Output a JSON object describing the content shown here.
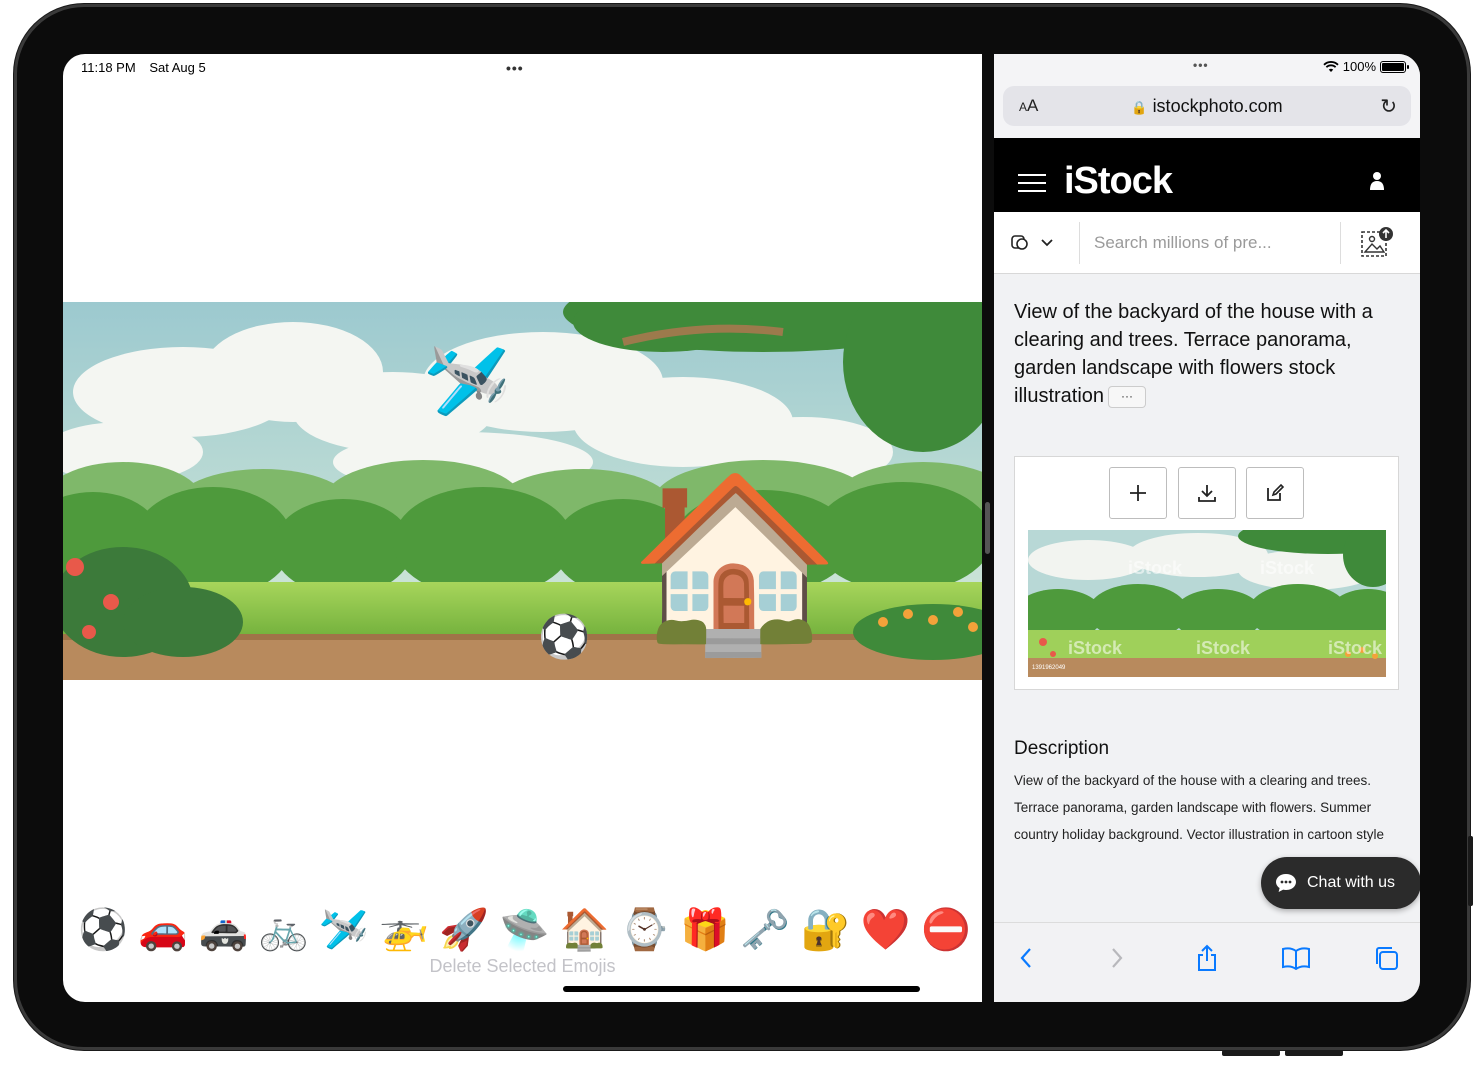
{
  "status_left": {
    "time": "11:18 PM",
    "date": "Sat Aug 5"
  },
  "multitask_dots": "•••",
  "emoji_tray": {
    "emojis": [
      "⚽",
      "🚗",
      "🚓",
      "🚲",
      "🛩️",
      "🚁",
      "🚀",
      "🛸",
      "🏠",
      "⌚",
      "🎁",
      "🗝️",
      "🔐",
      "❤️",
      "⛔"
    ],
    "delete_label": "Delete Selected Emojis"
  },
  "scene": {
    "emojis": {
      "plane": "🛩️",
      "house": "🏠",
      "ball": "⚽"
    }
  },
  "safari": {
    "status_dots": "•••",
    "battery": "100%",
    "url": "istockphoto.com",
    "aa_large": "A",
    "aa_small": "A"
  },
  "istock": {
    "logo": "iStock",
    "search_placeholder": "Search millions of pre...",
    "image_title": "View of the backyard of the house with a clearing and trees. Terrace panorama, garden landscape with flowers stock illustration",
    "more_label": "···",
    "description_heading": "Description",
    "description_body": "View of the backyard of the house with a clearing and trees. Terrace panorama, garden landscape with flowers. Summer country holiday background. Vector illustration in cartoon style",
    "chat_label": "Chat with us",
    "watermark": "iStock",
    "image_id": "1391962049"
  },
  "colors": {
    "istock_header": "#000000",
    "safari_accent": "#0a7aff",
    "chat_bg": "#2b2b2b"
  }
}
